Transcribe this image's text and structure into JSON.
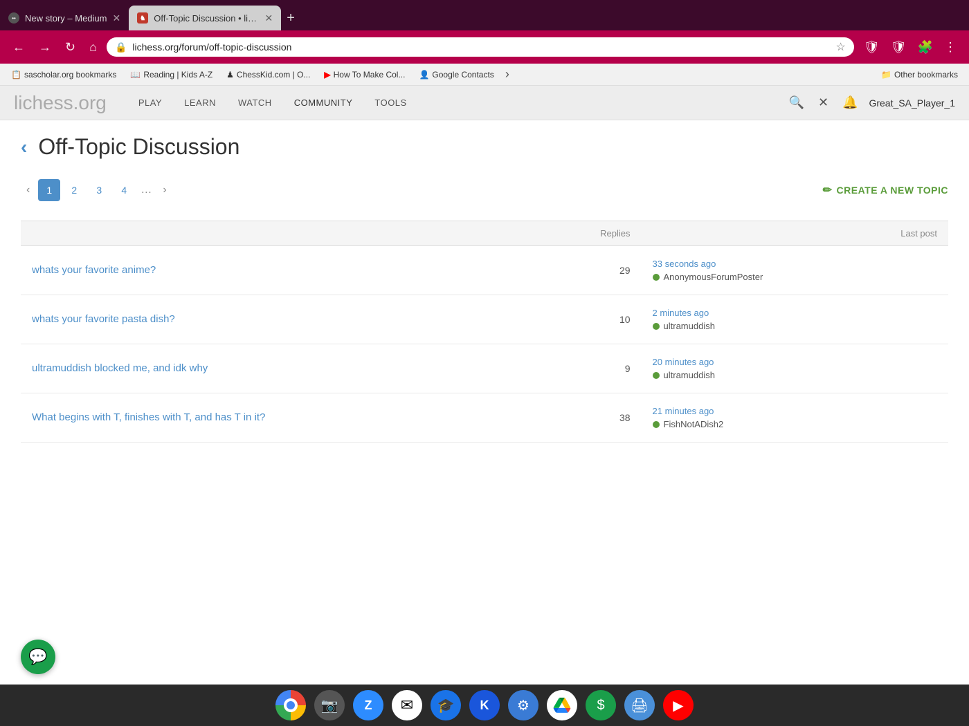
{
  "browser": {
    "tabs": [
      {
        "id": "tab-medium",
        "title": "New story – Medium",
        "favicon_color": "#333",
        "active": false
      },
      {
        "id": "tab-lichess",
        "title": "Off-Topic Discussion • lichess...",
        "favicon_color": "#c0392b",
        "active": true
      }
    ],
    "address": "lichess.org/forum/off-topic-discussion",
    "new_tab_label": "+",
    "back_label": "←",
    "forward_label": "→",
    "reload_label": "↻",
    "home_label": "⌂"
  },
  "bookmarks": [
    {
      "id": "bm-sascholar",
      "label": "sascholar.org bookmarks",
      "icon": "📋"
    },
    {
      "id": "bm-reading",
      "label": "Reading | Kids A-Z",
      "icon": "📖"
    },
    {
      "id": "bm-chesskid",
      "label": "ChessKid.com | O...",
      "icon": "♟"
    },
    {
      "id": "bm-youtube-how",
      "label": "How To Make Col...",
      "icon": "▶"
    },
    {
      "id": "bm-google-contacts",
      "label": "Google Contacts",
      "icon": "👤"
    },
    {
      "id": "bm-other",
      "label": "Other bookmarks",
      "icon": "📁"
    }
  ],
  "lichess": {
    "logo_main": "lichess",
    "logo_domain": ".org",
    "nav_items": [
      "PLAY",
      "LEARN",
      "WATCH",
      "COMMUNITY",
      "TOOLS"
    ],
    "username": "Great_SA_Player_1",
    "page_title": "Off-Topic Discussion",
    "back_arrow": "‹",
    "pagination": {
      "current": 1,
      "pages": [
        1,
        2,
        3,
        4
      ]
    },
    "create_topic_label": "CREATE A NEW TOPIC",
    "table_headers": {
      "topic": "",
      "replies": "Replies",
      "last_post": "Last post"
    },
    "topics": [
      {
        "id": "topic-1",
        "title": "whats your favorite anime?",
        "replies": 29,
        "last_post_time": "33 seconds ago",
        "last_post_user": "AnonymousForumPoster"
      },
      {
        "id": "topic-2",
        "title": "whats your favorite pasta dish?",
        "replies": 10,
        "last_post_time": "2 minutes ago",
        "last_post_user": "ultramuddish"
      },
      {
        "id": "topic-3",
        "title": "ultramuddish blocked me, and idk why",
        "replies": 9,
        "last_post_time": "20 minutes ago",
        "last_post_user": "ultramuddish"
      },
      {
        "id": "topic-4",
        "title": "What begins with T, finishes with T, and has T in it?",
        "replies": 38,
        "last_post_time": "21 minutes ago",
        "last_post_user": "FishNotADish2"
      }
    ]
  },
  "taskbar": {
    "icons": [
      {
        "id": "chrome",
        "label": "Chrome",
        "bg": "#fff"
      },
      {
        "id": "camera",
        "label": "Camera",
        "bg": "#555"
      },
      {
        "id": "zoom",
        "label": "Zoom",
        "bg": "#2d8cff"
      },
      {
        "id": "gmail",
        "label": "Gmail",
        "bg": "#fff"
      },
      {
        "id": "classroom",
        "label": "Google Classroom",
        "bg": "#1a73e8"
      },
      {
        "id": "k-app",
        "label": "K App",
        "bg": "#1a56db"
      },
      {
        "id": "settings",
        "label": "Settings",
        "bg": "#3a7bd5"
      },
      {
        "id": "drive",
        "label": "Google Drive",
        "bg": "#fff"
      },
      {
        "id": "cashapp",
        "label": "CashApp",
        "bg": "#1a9e4a"
      },
      {
        "id": "printer",
        "label": "Printer",
        "bg": "#4a90d9"
      },
      {
        "id": "youtube",
        "label": "YouTube",
        "bg": "#ff0000"
      }
    ]
  }
}
